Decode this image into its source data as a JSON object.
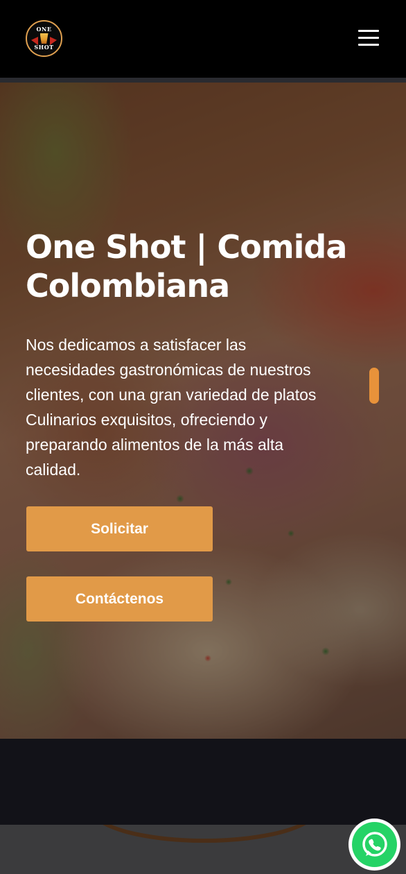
{
  "header": {
    "logo_top": "ONE",
    "logo_bottom": "SHOT",
    "menu_icon": "hamburger-menu-icon"
  },
  "hero": {
    "title": "One Shot | Comida Colombiana",
    "description": "Nos dedicamos a satisfacer las necesidades gastronómicas de nuestros clientes, con una gran variedad de platos Culinarios exquisitos, ofreciendo y preparando alimentos de la más alta calidad.",
    "buttons": {
      "solicitar": "Solicitar",
      "contact": "Contáctenos"
    }
  },
  "floating": {
    "whatsapp_icon": "whatsapp-icon"
  },
  "colors": {
    "accent": "#e19a48",
    "header_bg": "#000000",
    "whatsapp": "#25d366"
  }
}
